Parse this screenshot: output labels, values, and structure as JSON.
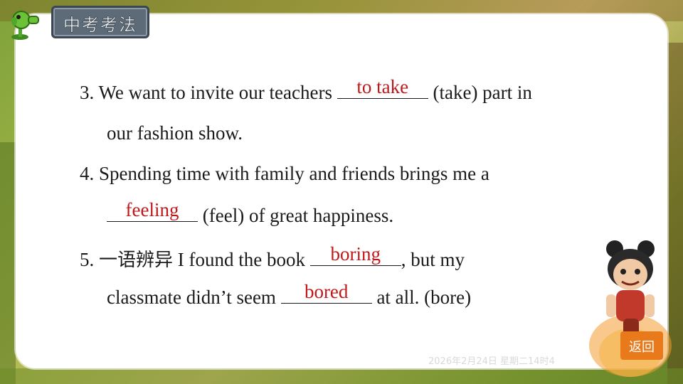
{
  "badge": {
    "title": "中考考法"
  },
  "questions": [
    {
      "number": "3.",
      "line1_before": "We want to invite our teachers",
      "answer": "to take",
      "line1_after": "(take) part in",
      "line2": "our fashion show."
    },
    {
      "number": "4.",
      "line1": "Spending time with family and friends brings me a",
      "answer": "feeling",
      "line2_after": "(feel) of great happiness."
    },
    {
      "number": "5.",
      "tag": "一语辨异",
      "line1_before": "I found the book",
      "answer1": "boring",
      "line1_after": ", but my",
      "line2_before": "classmate didn’t seem",
      "answer2": "bored",
      "line2_after": "at all. (bore)"
    }
  ],
  "footer": {
    "timestamp": "2026年2月24日 星期二14时4"
  },
  "nav": {
    "back_label": "返回"
  },
  "colors": {
    "answer": "#c0181a",
    "back_button": "#e87a1c",
    "badge_plate": "#5d6a77"
  }
}
